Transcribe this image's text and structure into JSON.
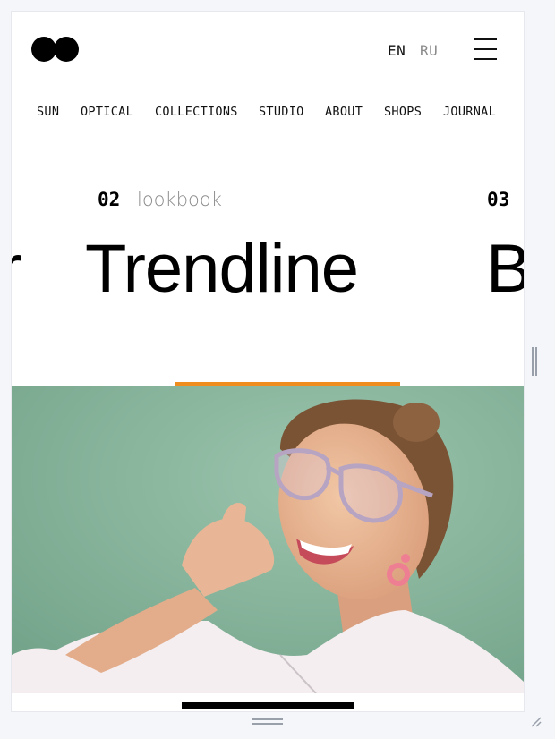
{
  "header": {
    "logo_name": "two-dots-logo",
    "languages": [
      {
        "label": "EN",
        "active": true
      },
      {
        "label": "RU",
        "active": false
      }
    ],
    "menu_icon": "hamburger-menu-icon"
  },
  "nav": {
    "items": [
      {
        "label": "SUN"
      },
      {
        "label": "OPTICAL"
      },
      {
        "label": "COLLECTIONS"
      },
      {
        "label": "STUDIO"
      },
      {
        "label": "ABOUT"
      },
      {
        "label": "SHOPS"
      },
      {
        "label": "JOURNAL"
      }
    ]
  },
  "slider": {
    "prev_title_fragment": "r",
    "current": {
      "number": "02",
      "tag": "lookbook",
      "title": "Trendline"
    },
    "next": {
      "number": "03",
      "title_fragment": "B"
    }
  },
  "colors": {
    "accent": "#ef8e1e",
    "photo_background": "#86b39a",
    "text": "#000000",
    "muted": "#8a8a8a"
  }
}
